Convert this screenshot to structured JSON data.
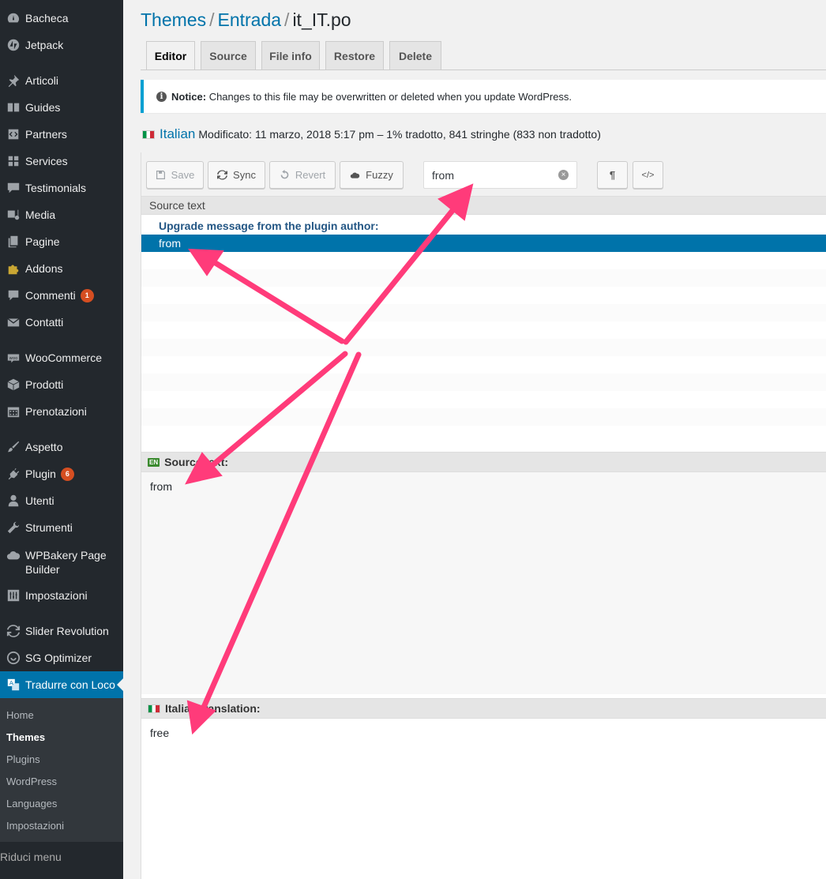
{
  "sidebar": {
    "items": [
      {
        "label": "Bacheca",
        "icon": "dashboard-icon"
      },
      {
        "label": "Jetpack",
        "icon": "jetpack-icon"
      },
      {
        "label": "Articoli",
        "icon": "pin-icon"
      },
      {
        "label": "Guides",
        "icon": "book-icon"
      },
      {
        "label": "Partners",
        "icon": "code-block-icon"
      },
      {
        "label": "Services",
        "icon": "grid-icon"
      },
      {
        "label": "Testimonials",
        "icon": "comment-icon"
      },
      {
        "label": "Media",
        "icon": "media-icon"
      },
      {
        "label": "Pagine",
        "icon": "page-icon"
      },
      {
        "label": "Addons",
        "icon": "puzzle-icon"
      },
      {
        "label": "Commenti",
        "icon": "speech-icon",
        "badge": "1"
      },
      {
        "label": "Contatti",
        "icon": "envelope-icon"
      },
      {
        "label": "WooCommerce",
        "icon": "woo-icon"
      },
      {
        "label": "Prodotti",
        "icon": "box-icon"
      },
      {
        "label": "Prenotazioni",
        "icon": "calendar-icon"
      },
      {
        "label": "Aspetto",
        "icon": "brush-icon"
      },
      {
        "label": "Plugin",
        "icon": "plug-icon",
        "badge": "6"
      },
      {
        "label": "Utenti",
        "icon": "user-icon"
      },
      {
        "label": "Strumenti",
        "icon": "wrench-icon"
      },
      {
        "label": "WPBakery Page Builder",
        "label_line1": "WPBakery Page",
        "label_line2": "Builder",
        "icon": "cloud-icon"
      },
      {
        "label": "Impostazioni",
        "icon": "settings-icon"
      },
      {
        "label": "Slider Revolution",
        "icon": "refresh-icon"
      },
      {
        "label": "SG Optimizer",
        "icon": "sg-icon"
      },
      {
        "label": "Tradurre con Loco",
        "icon": "translate-icon"
      }
    ],
    "submenu": [
      "Home",
      "Themes",
      "Plugins",
      "WordPress",
      "Languages",
      "Impostazioni"
    ],
    "collapse_label": "Riduci menu"
  },
  "header": {
    "crumb1": "Themes",
    "crumb2": "Entrada",
    "sep": "/",
    "file": "it_IT.po"
  },
  "tabs": [
    "Editor",
    "Source",
    "File info",
    "Restore",
    "Delete"
  ],
  "notice": {
    "strong": "Notice:",
    "text": "Changes to this file may be overwritten or deleted when you update WordPress."
  },
  "locale": {
    "name": "Italian",
    "meta": "Modificato: 11 marzo, 2018 5:17 pm – 1% tradotto, 841 stringhe (833 non tradotto)"
  },
  "toolbar": {
    "save": "Save",
    "sync": "Sync",
    "revert": "Revert",
    "fuzzy": "Fuzzy",
    "search_value": "from",
    "pilcrow": "¶",
    "code": "</>"
  },
  "list": {
    "header": "Source text",
    "group": "Upgrade message from the plugin author:",
    "selected": "from"
  },
  "source_pane": {
    "badge": "EN",
    "title": "Source text:",
    "value": "from"
  },
  "target_pane": {
    "title": "Italian translation:",
    "value": "free"
  },
  "colors": {
    "sidebar_bg": "#23282d",
    "accent": "#0073aa",
    "arrow": "#ff3b7a",
    "badge": "#d54e21"
  }
}
